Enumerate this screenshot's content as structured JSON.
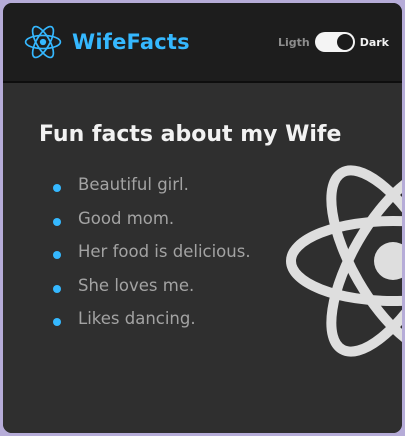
{
  "colors": {
    "page_background": "#b6acd8",
    "navbar": "#1d1d1d",
    "content": "#2f2f2f",
    "accent": "#35b8ff",
    "logo_watermark": "#dedede"
  },
  "navbar": {
    "logo_icon": "react-atom-icon",
    "brand": "WifeFacts",
    "theme_toggle": {
      "light_label": "Ligth",
      "dark_label": "Dark",
      "selected": "dark"
    }
  },
  "main": {
    "title": "Fun facts about my Wife",
    "facts": [
      "Beautiful girl.",
      "Good mom.",
      "Her food is delicious.",
      "She loves me.",
      "Likes dancing."
    ],
    "background_icon": "react-atom-icon"
  }
}
